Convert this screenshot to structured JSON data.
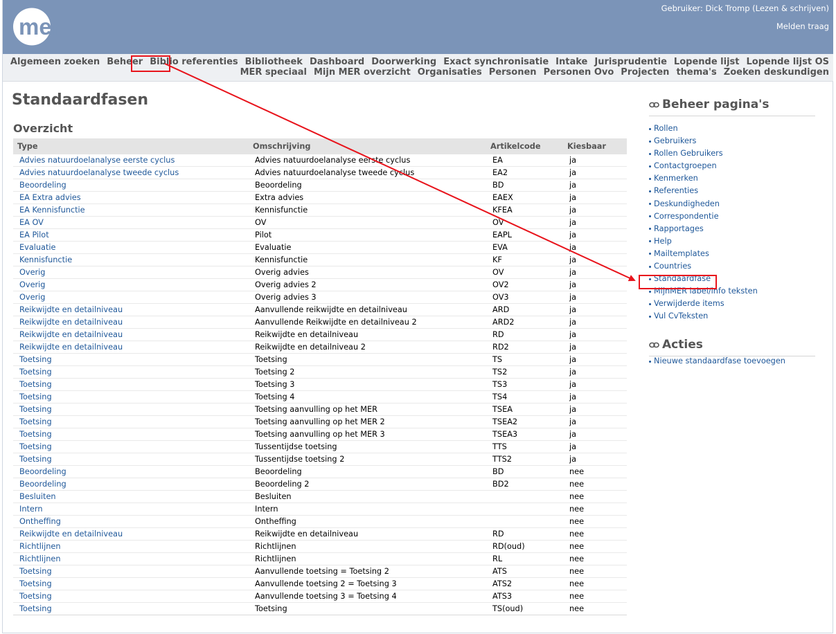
{
  "header": {
    "logo_text": "mer",
    "user_label": "Gebruiker: Dick Tromp (Lezen & schrijven)",
    "logout_label": "Melden traag"
  },
  "nav": {
    "row1": [
      "Algemeen zoeken",
      "Beheer",
      "Biblio referenties",
      "Bibliotheek",
      "Dashboard",
      "Doorwerking",
      "Exact synchronisatie",
      "Intake",
      "Jurisprudentie",
      "Lopende lijst",
      "Lopende lijst OS"
    ],
    "row2": [
      "MER speciaal",
      "Mijn MER overzicht",
      "Organisaties",
      "Personen",
      "Personen Ovo",
      "Projecten",
      "thema's",
      "Zoeken deskundigen"
    ]
  },
  "page": {
    "title": "Standaardfasen",
    "section": "Overzicht"
  },
  "table": {
    "headers": [
      "Type",
      "Omschrijving",
      "Artikelcode",
      "Kiesbaar"
    ],
    "rows": [
      [
        "Advies natuurdoelanalyse eerste cyclus",
        "Advies natuurdoelanalyse eerste cyclus",
        "EA",
        "ja"
      ],
      [
        "Advies natuurdoelanalyse tweede cyclus",
        "Advies natuurdoelanalyse tweede cyclus",
        "EA2",
        "ja"
      ],
      [
        "Beoordeling",
        "Beoordeling",
        "BD",
        "ja"
      ],
      [
        "EA Extra advies",
        "Extra advies",
        "EAEX",
        "ja"
      ],
      [
        "EA Kennisfunctie",
        "Kennisfunctie",
        "KFEA",
        "ja"
      ],
      [
        "EA OV",
        "OV",
        "OV",
        "ja"
      ],
      [
        "EA Pilot",
        "Pilot",
        "EAPL",
        "ja"
      ],
      [
        "Evaluatie",
        "Evaluatie",
        "EVA",
        "ja"
      ],
      [
        "Kennisfunctie",
        "Kennisfunctie",
        "KF",
        "ja"
      ],
      [
        "Overig",
        "Overig advies",
        "OV",
        "ja"
      ],
      [
        "Overig",
        "Overig advies 2",
        "OV2",
        "ja"
      ],
      [
        "Overig",
        "Overig advies 3",
        "OV3",
        "ja"
      ],
      [
        "Reikwijdte en detailniveau",
        "Aanvullende reikwijdte en detailniveau",
        "ARD",
        "ja"
      ],
      [
        "Reikwijdte en detailniveau",
        "Aanvullende Reikwijdte en detailniveau 2",
        "ARD2",
        "ja"
      ],
      [
        "Reikwijdte en detailniveau",
        "Reikwijdte en detailniveau",
        "RD",
        "ja"
      ],
      [
        "Reikwijdte en detailniveau",
        "Reikwijdte en detailniveau 2",
        "RD2",
        "ja"
      ],
      [
        "Toetsing",
        "Toetsing",
        "TS",
        "ja"
      ],
      [
        "Toetsing",
        "Toetsing 2",
        "TS2",
        "ja"
      ],
      [
        "Toetsing",
        "Toetsing 3",
        "TS3",
        "ja"
      ],
      [
        "Toetsing",
        "Toetsing 4",
        "TS4",
        "ja"
      ],
      [
        "Toetsing",
        "Toetsing aanvulling op het MER",
        "TSEA",
        "ja"
      ],
      [
        "Toetsing",
        "Toetsing aanvulling op het MER 2",
        "TSEA2",
        "ja"
      ],
      [
        "Toetsing",
        "Toetsing aanvulling op het MER 3",
        "TSEA3",
        "ja"
      ],
      [
        "Toetsing",
        "Tussentijdse toetsing",
        "TTS",
        "ja"
      ],
      [
        "Toetsing",
        "Tussentijdse toetsing 2",
        "TTS2",
        "ja"
      ],
      [
        "Beoordeling",
        "Beoordeling",
        "BD",
        "nee"
      ],
      [
        "Beoordeling",
        "Beoordeling 2",
        "BD2",
        "nee"
      ],
      [
        "Besluiten",
        "Besluiten",
        "",
        "nee"
      ],
      [
        "Intern",
        "Intern",
        "",
        "nee"
      ],
      [
        "Ontheffing",
        "Ontheffing",
        "",
        "nee"
      ],
      [
        "Reikwijdte en detailniveau",
        "Reikwijdte en detailniveau",
        "RD",
        "nee"
      ],
      [
        "Richtlijnen",
        "Richtlijnen",
        "RD(oud)",
        "nee"
      ],
      [
        "Richtlijnen",
        "Richtlijnen",
        "RL",
        "nee"
      ],
      [
        "Toetsing",
        "Aanvullende toetsing = Toetsing 2",
        "ATS",
        "nee"
      ],
      [
        "Toetsing",
        "Aanvullende toetsing 2 = Toetsing 3",
        "ATS2",
        "nee"
      ],
      [
        "Toetsing",
        "Aanvullende toetsing 3 = Toetsing 4",
        "ATS3",
        "nee"
      ],
      [
        "Toetsing",
        "Toetsing",
        "TS(oud)",
        "nee"
      ]
    ]
  },
  "sidebar": {
    "admin_title": "Beheer pagina's",
    "admin_items": [
      "Rollen",
      "Gebruikers",
      "Rollen Gebruikers",
      "Contactgroepen",
      "Kenmerken",
      "Referenties",
      "Deskundigheden",
      "Correspondentie",
      "Rapportages",
      "Help",
      "Mailtemplates",
      "Countries",
      "Standaardfase",
      "MijnMER label/info teksten",
      "Verwijderde items",
      "Vul CvTeksten"
    ],
    "actions_title": "Acties",
    "action_items": [
      "Nieuwe standaardfase toevoegen"
    ],
    "link_icon": "chain-link-icon"
  },
  "annotation": {
    "color": "#e8141c"
  },
  "colors": {
    "header": "#7b94b8",
    "link": "#1e5799",
    "heading": "#555555"
  }
}
